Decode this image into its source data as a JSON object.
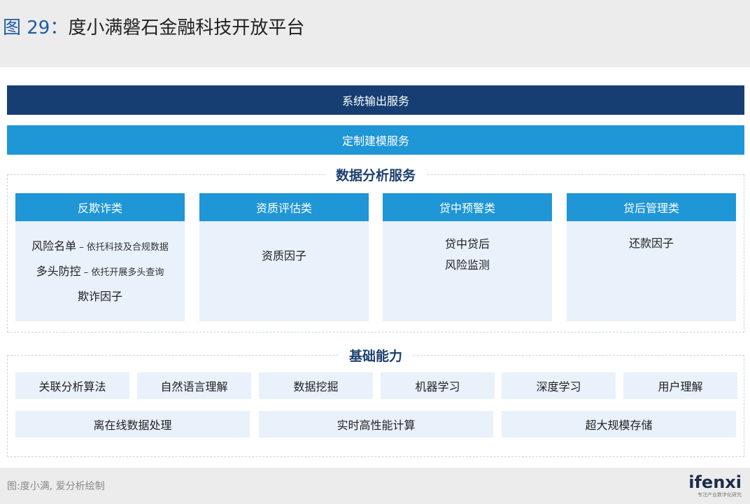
{
  "header": {
    "fig_label": "图 29：",
    "title": "度小满磐石金融科技开放平台"
  },
  "layers": {
    "output_service": "系统输出服务",
    "modeling_service": "定制建模服务"
  },
  "analysis": {
    "section_title": "数据分析服务",
    "columns": [
      {
        "head": "反欺诈类",
        "rows": [
          {
            "main": "风险名单",
            "sub": " – 依托科技及合规数据"
          },
          {
            "main": "多头防控",
            "sub": " – 依托开展多头查询"
          },
          {
            "main": "欺诈因子",
            "sub": ""
          }
        ]
      },
      {
        "head": "资质评估类",
        "rows": [
          {
            "main": "资质因子"
          }
        ]
      },
      {
        "head": "贷中预警类",
        "rows": [
          {
            "main": "贷中贷后"
          },
          {
            "main": "风险监测"
          }
        ]
      },
      {
        "head": "贷后管理类",
        "rows": [
          {
            "main": "还款因子"
          }
        ]
      }
    ]
  },
  "base": {
    "section_title": "基础能力",
    "row1": [
      "关联分析算法",
      "自然语言理解",
      "数据挖掘",
      "机器学习",
      "深度学习",
      "用户理解"
    ],
    "row2": [
      "离在线数据处理",
      "实时高性能计算",
      "超大规模存储"
    ]
  },
  "footer": {
    "source": "图:度小满, 爱分析绘制",
    "logo": "ifenxi",
    "logo_tagline": "专注产业数字化研究"
  },
  "colors": {
    "dark_band": "#163e73",
    "accent_blue": "#1f96d6",
    "cell_bg": "#e9f1fa",
    "title_blue": "#1e5aa8"
  }
}
